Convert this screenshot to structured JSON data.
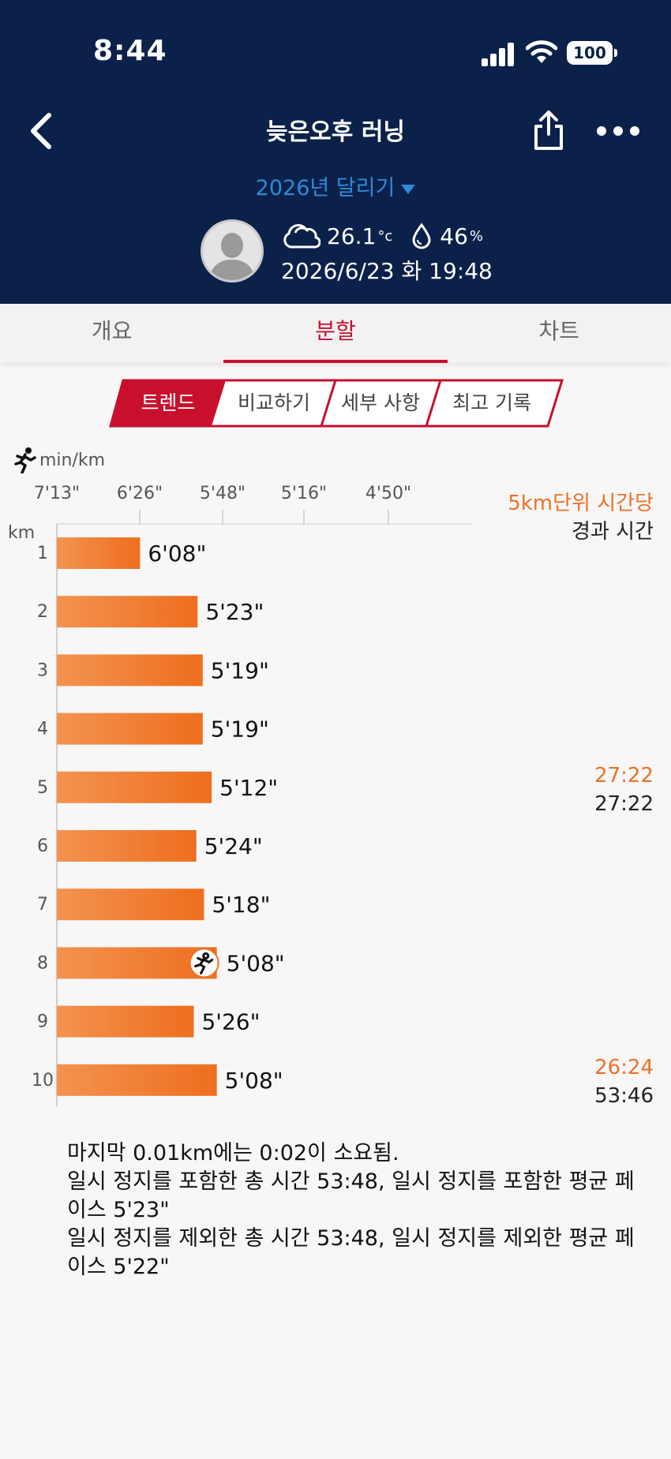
{
  "status_bar": {
    "time": "8:44",
    "battery": "100"
  },
  "header": {
    "title": "늦은오후 러닝",
    "year_selector": "2026년 달리기",
    "weather": {
      "temperature": "26.1",
      "temperature_unit": "°c",
      "humidity": "46",
      "humidity_unit": "%"
    },
    "datetime": "2026/6/23 화 19:48",
    "icons": {
      "back": "chevron-left-icon",
      "share": "share-icon",
      "more": "more-icon",
      "weather": "cloud-icon",
      "humidity": "droplet-icon"
    }
  },
  "tabs": [
    {
      "label": "개요",
      "active": false
    },
    {
      "label": "분할",
      "active": true
    },
    {
      "label": "차트",
      "active": false
    }
  ],
  "segments": [
    {
      "label": "트렌드",
      "active": true
    },
    {
      "label": "비교하기",
      "active": false
    },
    {
      "label": "세부 사항",
      "active": false
    },
    {
      "label": "최고 기록",
      "active": false
    }
  ],
  "colors": {
    "navy": "#0b2149",
    "accent_red": "#c8102e",
    "bar_orange": "#ee7026",
    "link_blue": "#2e8ad8"
  },
  "chart_labels": {
    "pace_unit": "min/km",
    "km_label": "km",
    "split_header_line1": "5km단위 시간당",
    "split_header_line2": "경과 시간"
  },
  "chart_data": {
    "type": "bar",
    "orientation": "horizontal",
    "y_axis_label": "km",
    "x_axis_label": "min/km",
    "x_ticks": [
      "7'13\"",
      "6'26\"",
      "5'48\"",
      "5'16\"",
      "4'50\""
    ],
    "categories": [
      "1",
      "2",
      "3",
      "4",
      "5",
      "6",
      "7",
      "8",
      "9",
      "10"
    ],
    "value_labels": [
      "6'08\"",
      "5'23\"",
      "5'19\"",
      "5'19\"",
      "5'12\"",
      "5'24\"",
      "5'18\"",
      "5'08\"",
      "5'26\"",
      "5'08\""
    ],
    "values_seconds_per_km": [
      368,
      323,
      319,
      319,
      312,
      324,
      318,
      308,
      326,
      308
    ],
    "fastest_marker_km": "8",
    "split_totals": [
      {
        "at_km": "5",
        "split_time": "27:22",
        "elapsed_time": "27:22"
      },
      {
        "at_km": "10",
        "split_time": "26:24",
        "elapsed_time": "53:46"
      }
    ]
  },
  "summary_notes": [
    "마지막 0.01km에는 0:02이 소요됨.",
    "일시 정지를 포함한 총 시간 53:48, 일시 정지를 포함한 평균 페이스 5'23\"",
    "일시 정지를 제외한 총 시간 53:48, 일시 정지를 제외한 평균 페이스 5'22\""
  ]
}
